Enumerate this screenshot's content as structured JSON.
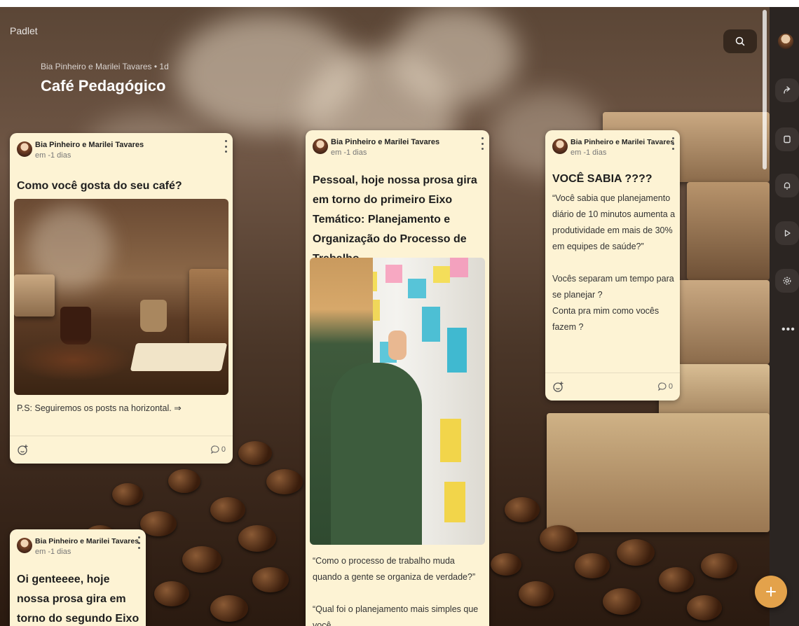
{
  "app": {
    "brand": "Padlet"
  },
  "board": {
    "meta": "Bia Pinheiro e Marilei Tavares • 1d",
    "title": "Café Pedagógico"
  },
  "icons": {
    "search": "search-icon",
    "share": "share-icon",
    "remake": "remake-icon",
    "notifications": "bell-icon",
    "slideshow": "play-icon",
    "settings": "gear-icon",
    "more": "more-icon",
    "add": "plus-icon"
  },
  "colors": {
    "card_bg": "#fdf3d4",
    "fab": "#e3a24b",
    "rail": "#2b2522"
  },
  "rail": {
    "more_label": "•••"
  },
  "posts": [
    {
      "author": "Bia Pinheiro e Marilei Tavares",
      "date": "em -1 dias",
      "title": "Como você gosta do seu café?",
      "body": "P.S: Seguiremos os posts na horizontal. ⇒",
      "comments": "0"
    },
    {
      "author": "Bia Pinheiro e Marilei Tavares",
      "date": "em -1 dias",
      "title": "Pessoal, hoje nossa prosa gira em torno do primeiro Eixo Temático: Planejamento e Organização do Processo de Trabalho",
      "body": "“Como o processo de trabalho muda quando a gente se organiza de verdade?”\n\n“Qual foi o planejamento mais simples que você"
    },
    {
      "author": "Bia Pinheiro e Marilei Tavares",
      "date": "em -1 dias",
      "title": "VOCÊ SABIA ????",
      "body": "“Você sabia que planejamento diário de 10 minutos aumenta a produtividade em mais de 30% em equipes de saúde?”\n\nVocês separam um tempo para se planejar ?\nConta pra mim como vocês fazem ?",
      "comments": "0"
    },
    {
      "author": "Bia Pinheiro e Marilei Tavares",
      "date": "em -1 dias",
      "title": "Oi genteeee, hoje nossa prosa gira em torno do segundo Eixo Temático:"
    }
  ]
}
